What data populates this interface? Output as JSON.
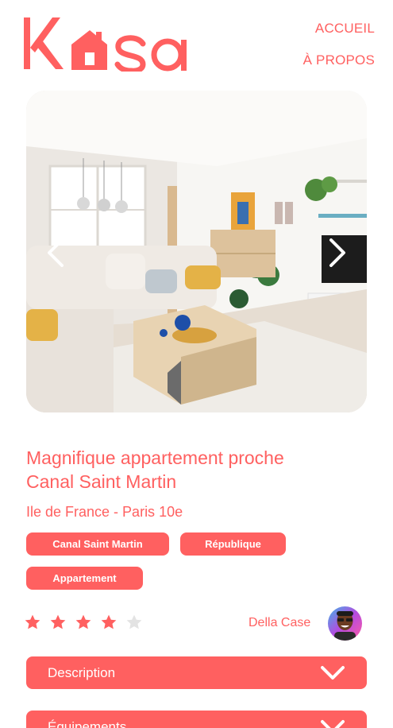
{
  "header": {
    "logo_text": "Kasa",
    "nav": [
      {
        "label": "ACCUEIL"
      },
      {
        "label": "À PROPOS"
      }
    ]
  },
  "gallery": {
    "image_alt": "Salon lumineux avec canapé d'angle, table basse et plantes",
    "prev_icon": "chevron-left-icon",
    "next_icon": "chevron-right-icon"
  },
  "listing": {
    "title": "Magnifique appartement proche Canal Saint Martin",
    "location": "Ile de France - Paris 10e",
    "tags": [
      "Canal Saint Martin",
      "République",
      "Appartement"
    ],
    "rating": 4,
    "rating_max": 5,
    "host_name": "Della Case"
  },
  "collapses": [
    {
      "label": "Description",
      "icon": "chevron-down-icon"
    },
    {
      "label": "Équipements",
      "icon": "chevron-down-icon"
    }
  ],
  "colors": {
    "brand": "#FF6060",
    "star_empty": "#E3E3E3",
    "text_on_brand": "#FFFFFF"
  }
}
